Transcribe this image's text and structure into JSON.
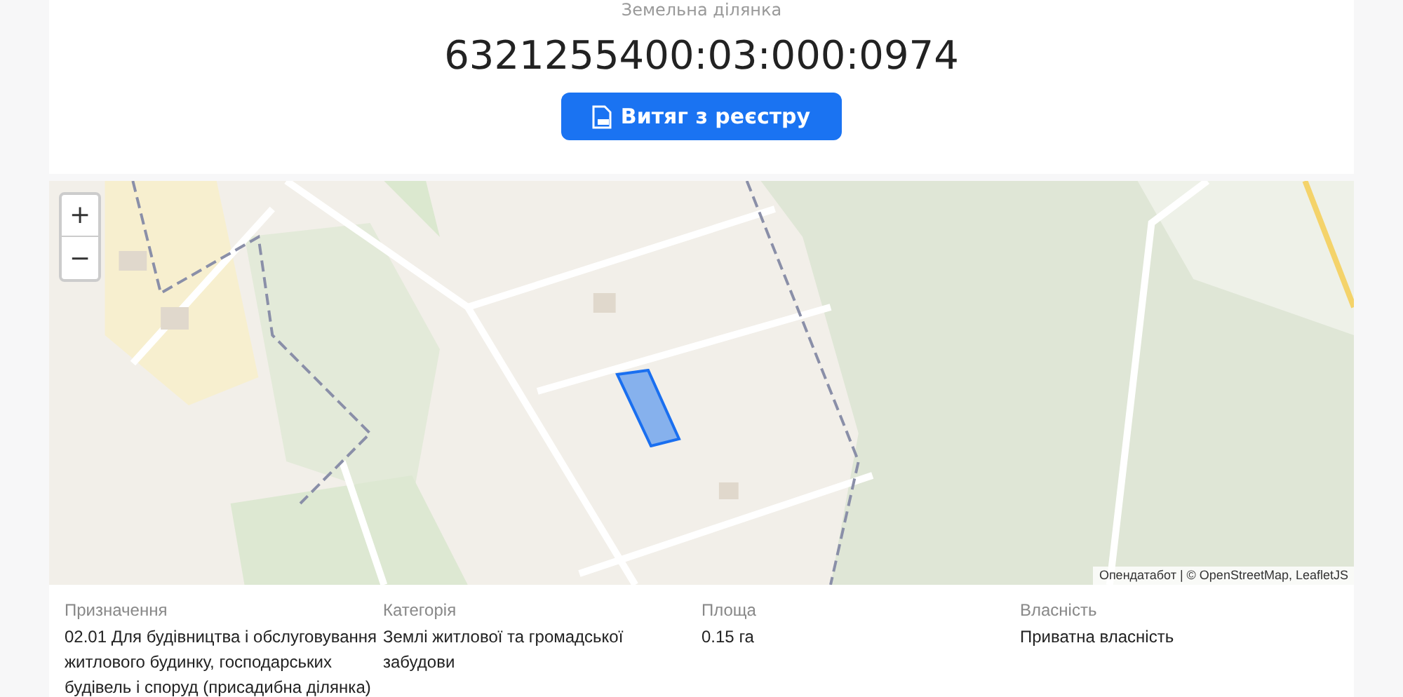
{
  "header": {
    "label": "Земельна ділянка",
    "cadastral_number": "6321255400:03:000:0974",
    "button": "Витяг з реєстру"
  },
  "map": {
    "kind": "picture",
    "zoom_in": "+",
    "zoom_out": "−",
    "attribution": "Опендатабот | © OpenStreetMap, LeafletJS"
  },
  "details": [
    {
      "label": "Призначення",
      "value": "02.01 Для будівництва і обслуговування житлового будинку, господарських будівель і споруд (присадибна ділянка)"
    },
    {
      "label": "Категорія",
      "value": "Землі житлової та громадської забудови"
    },
    {
      "label": "Площа",
      "value": "0.15 га"
    },
    {
      "label": "Власність",
      "value": "Приватна власність"
    }
  ]
}
